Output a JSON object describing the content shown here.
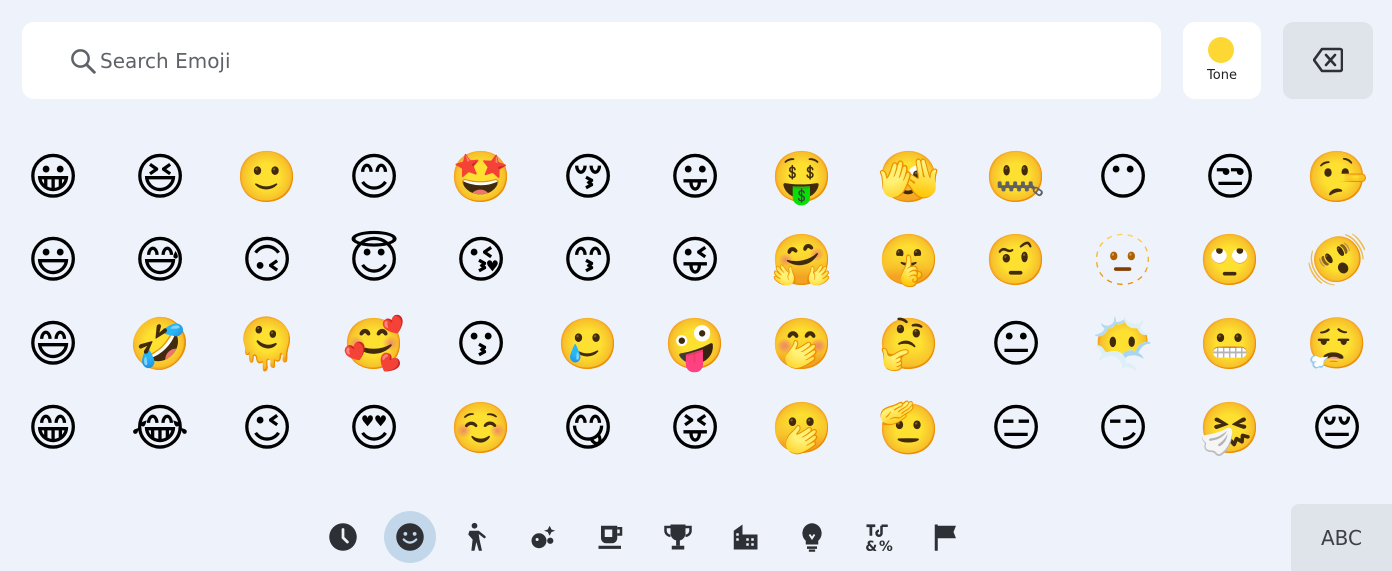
{
  "search": {
    "placeholder": "Search Emoji"
  },
  "tone": {
    "label": "Tone",
    "color": "#fdd835"
  },
  "keyboard_switch": {
    "label": "ABC"
  },
  "emoji_rows": [
    [
      "😀",
      "😆",
      "🙂",
      "😊",
      "🤩",
      "😚",
      "😛",
      "🤑",
      "🫣",
      "🤐",
      "😶",
      "😒",
      "🤥"
    ],
    [
      "😃",
      "😅",
      "🙃",
      "😇",
      "😘",
      "😙",
      "😜",
      "🤗",
      "🤫",
      "🤨",
      "🫥",
      "🙄",
      "🫨"
    ],
    [
      "😄",
      "🤣",
      "🫠",
      "🥰",
      "😗",
      "🥲",
      "🤪",
      "🤭",
      "🤔",
      "😐",
      "😶‍🌫️",
      "😬",
      "😮‍💨"
    ],
    [
      "😁",
      "😂",
      "😉",
      "😍",
      "☺️",
      "😋",
      "😝",
      "🫢",
      "🫡",
      "😑",
      "😏",
      "🤧",
      "😔"
    ]
  ],
  "categories": [
    {
      "name": "recent",
      "icon": "clock-icon",
      "active": false
    },
    {
      "name": "smileys",
      "icon": "smiley-icon",
      "active": true
    },
    {
      "name": "people",
      "icon": "person-icon",
      "active": false
    },
    {
      "name": "animals-nature",
      "icon": "animal-icon",
      "active": false
    },
    {
      "name": "food-drink",
      "icon": "cup-icon",
      "active": false
    },
    {
      "name": "activities",
      "icon": "trophy-icon",
      "active": false
    },
    {
      "name": "travel-places",
      "icon": "building-icon",
      "active": false
    },
    {
      "name": "objects",
      "icon": "lightbulb-icon",
      "active": false
    },
    {
      "name": "symbols",
      "icon": "symbols-icon",
      "active": false
    },
    {
      "name": "flags",
      "icon": "flag-icon",
      "active": false
    }
  ],
  "colors": {
    "background": "#eef3fb",
    "active_category": "#c2d8ea",
    "icon": "#2d3035"
  }
}
